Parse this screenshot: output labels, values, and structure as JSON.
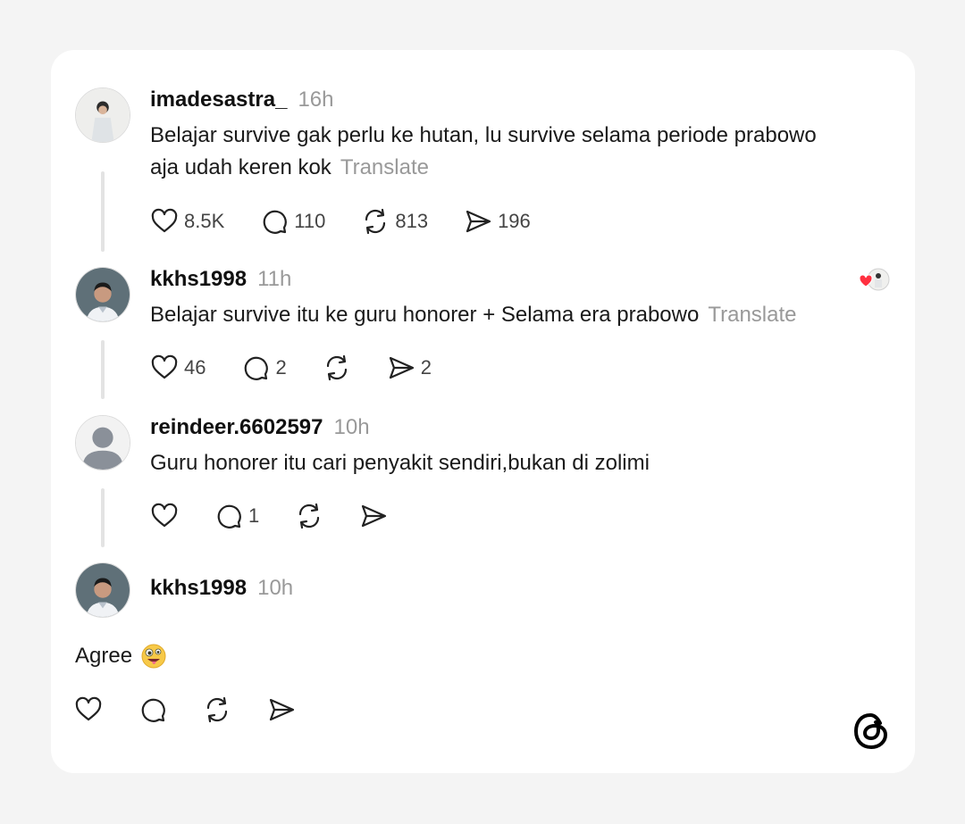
{
  "brand": {
    "logo_icon": "threads-logo-icon"
  },
  "posts": [
    {
      "username": "imadesastra_",
      "time": "16h",
      "text_line1": "Belajar survive gak perlu ke hutan, lu survive selama periode prabowo",
      "text_line2": "aja udah keren kok",
      "translate": "Translate",
      "stats": {
        "likes": "8.5K",
        "replies": "110",
        "reposts": "813",
        "shares": "196"
      }
    },
    {
      "username": "kkhs1998",
      "time": "11h",
      "text": "Belajar survive itu ke guru honorer + Selama era prabowo",
      "translate": "Translate",
      "liked_by_author": true,
      "stats": {
        "likes": "46",
        "replies": "2",
        "reposts": "",
        "shares": "2"
      }
    },
    {
      "username": "reindeer.6602597",
      "time": "10h",
      "text": "Guru honorer itu cari penyakit sendiri,bukan di zolimi",
      "stats": {
        "likes": "",
        "replies": "1",
        "reposts": "",
        "shares": ""
      }
    },
    {
      "username": "kkhs1998",
      "time": "10h",
      "text": "Agree",
      "emoji": "zany-face-emoji"
    }
  ],
  "colors": {
    "accent_like": "#ff3040",
    "muted": "#999999"
  }
}
